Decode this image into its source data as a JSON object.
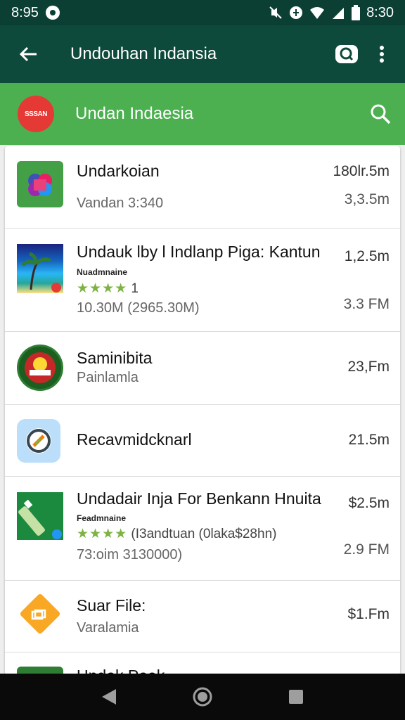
{
  "status": {
    "left_time": "8:95",
    "right_time": "8:30"
  },
  "appbar": {
    "title": "Undouhan Indansia"
  },
  "search": {
    "text": "Undan Indaesia",
    "logo_text": "SSSAN",
    "accent": "#4caf50"
  },
  "items": [
    {
      "name": "Undarkoian",
      "sub": "Vandan 3:340",
      "size1": "180lr.5m",
      "size2": "3,3.5m",
      "icon": "puzzle-icon"
    },
    {
      "name": "Undauk lby l Indlanp Piga: Kantun",
      "tiny": "Nuadmnaine",
      "stars": "★★★★",
      "rating": "1",
      "sub": "10.30M (2965.30M)",
      "size1": "1,2.5m",
      "size2": "3.3 FM",
      "icon": "beach-icon"
    },
    {
      "name": "Saminibita",
      "sub": "Painlamla",
      "size1": "23,Fm",
      "icon": "badge-icon"
    },
    {
      "name": "Recavmidcknarl",
      "size1": "21.5m",
      "icon": "sync-icon"
    },
    {
      "name": "Undadair Inja For Benkann Hnuita",
      "tiny": "Feadmnaine",
      "stars": "★★★★",
      "rating": "(I3andtuan (0laka$28hn)",
      "sub": "73:oim 3130000)",
      "size1": "$2.5m",
      "size2": "2.9 FM",
      "icon": "usb-icon"
    },
    {
      "name": "Suar File:",
      "sub": "Varalamia",
      "size1": "$1.Fm",
      "icon": "file-icon"
    },
    {
      "name": "Undak Paak",
      "icon": "partial-icon"
    }
  ]
}
